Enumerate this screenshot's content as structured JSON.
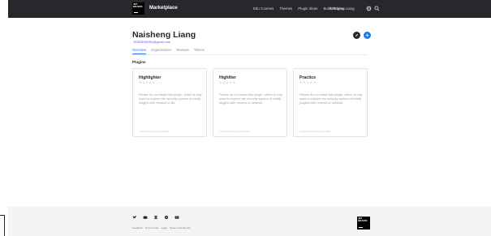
{
  "nav": {
    "logo_text": [
      "JET",
      "BRAINS"
    ],
    "brand": "Marketplace",
    "links": [
      "Edu Courses",
      "Themes",
      "Plugin Ideas",
      "Build Plugins"
    ],
    "user": "Naisheng Liang",
    "icons": [
      "settings-icon",
      "search-icon"
    ]
  },
  "profile": {
    "name": "Naisheng Liang",
    "email": "1028083849liu@gmail.com",
    "edit_icon": "pencil-icon",
    "add_icon": "plus-icon",
    "tabs": [
      "Overview",
      "Organizations",
      "Reviews",
      "Tokens"
    ],
    "active_tab": "Overview"
  },
  "plugins": {
    "section_title": "Plugins",
    "stars": "★★★★★",
    "cards": [
      {
        "title": "Highlighter",
        "description": "Please do not install this plugin, which is only used to explore the security system of intellij plugins with respect to file.",
        "footer": "0 downloads  Not rated  Incompatible"
      },
      {
        "title": "Highliter",
        "description": "Please do not install this plugin, which is only used to explore the security system of intellij plugins with respect to network.",
        "footer": "0 downloads  Not rated  Incompatible"
      },
      {
        "title": "Practice",
        "description": "Please do not install this plugin, which is only used to explore the security system of intellij plugins with respect to network.",
        "footer": "0 downloads  Not rated  Incompatible"
      }
    ]
  },
  "footer": {
    "social": [
      "twitter-icon",
      "youtube-icon",
      "slack-icon",
      "reddit-icon",
      "video-icon"
    ],
    "links": [
      "Feedback",
      "Terms of Use",
      "Legal",
      "Privacy and Security"
    ],
    "logo_text": [
      "JET",
      "BRAINS"
    ]
  },
  "colors": {
    "nav_bg": "#27282c",
    "accent": "#1a7ee8",
    "link": "#6b57ff",
    "footer_bg": "#f4f4f4"
  }
}
